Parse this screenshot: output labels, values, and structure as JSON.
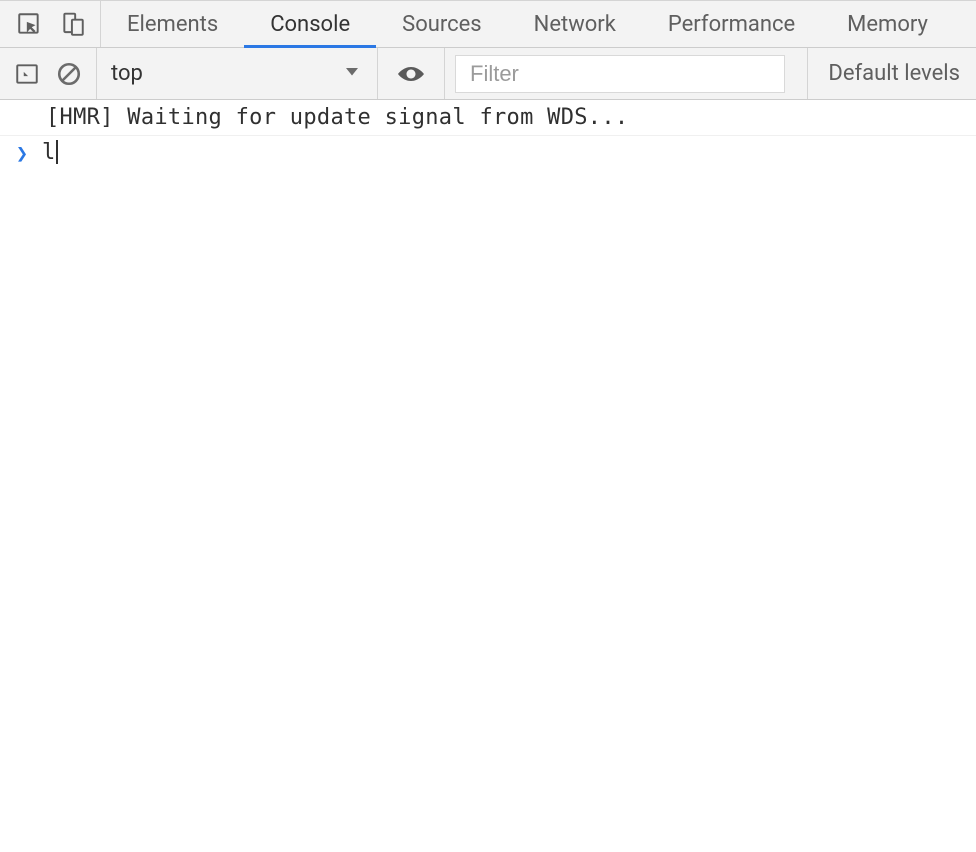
{
  "tabs": {
    "items": [
      {
        "label": "Elements"
      },
      {
        "label": "Console"
      },
      {
        "label": "Sources"
      },
      {
        "label": "Network"
      },
      {
        "label": "Performance"
      },
      {
        "label": "Memory"
      }
    ],
    "activeIndex": 1
  },
  "toolbar": {
    "context": "top",
    "filterPlaceholder": "Filter",
    "filterValue": "",
    "levelsLabel": "Default levels"
  },
  "console": {
    "log0": "[HMR] Waiting for update signal from WDS...",
    "promptValue": "l"
  }
}
